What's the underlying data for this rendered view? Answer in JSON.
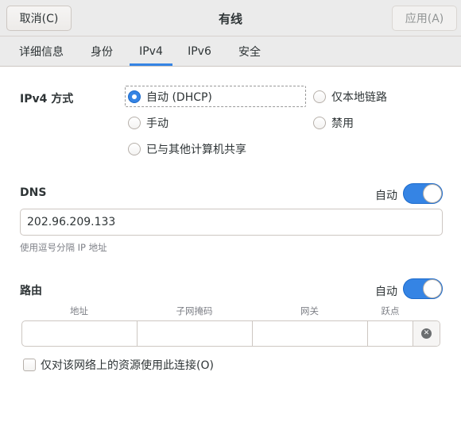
{
  "header": {
    "cancel_label": "取消(C)",
    "title": "有线",
    "apply_label": "应用(A)"
  },
  "tabs": [
    {
      "label": "详细信息",
      "active": false
    },
    {
      "label": "身份",
      "active": false
    },
    {
      "label": "IPv4",
      "active": true
    },
    {
      "label": "IPv6",
      "active": false
    },
    {
      "label": "安全",
      "active": false
    }
  ],
  "ipv4_method": {
    "label": "IPv4 方式",
    "options": [
      {
        "label": "自动 (DHCP)",
        "checked": true
      },
      {
        "label": "仅本地链路",
        "checked": false
      },
      {
        "label": "手动",
        "checked": false
      },
      {
        "label": "禁用",
        "checked": false
      },
      {
        "label": "已与其他计算机共享",
        "checked": false
      }
    ]
  },
  "dns": {
    "label": "DNS",
    "auto_label": "自动",
    "auto_enabled": true,
    "value": "202.96.209.133",
    "hint": "使用逗号分隔 IP 地址"
  },
  "routes": {
    "label": "路由",
    "auto_label": "自动",
    "auto_enabled": true,
    "columns": [
      "地址",
      "子网掩码",
      "网关",
      "跃点"
    ],
    "rows": [
      {
        "address": "",
        "netmask": "",
        "gateway": "",
        "metric": ""
      }
    ]
  },
  "only_local_resources": {
    "label": "仅对该网络上的资源使用此连接(O)",
    "checked": false
  },
  "colors": {
    "accent": "#3584e4",
    "header_bg": "#ebebeb"
  }
}
